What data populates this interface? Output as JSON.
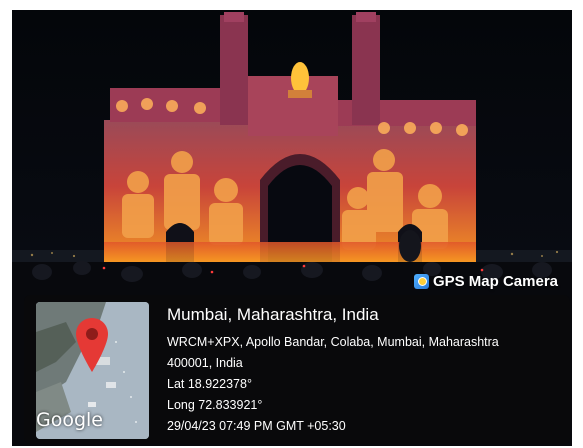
{
  "watermark": {
    "label": "GPS Map Camera",
    "icon": "gps-map-camera-icon"
  },
  "map": {
    "provider": "Google",
    "pin_color": "#e53935"
  },
  "location": {
    "city_line": "Mumbai, Maharashtra, India",
    "address_line1": "WRCM+XPX, Apollo Bandar, Colaba, Mumbai, Maharashtra",
    "address_line2": "400001, India",
    "lat": "Lat 18.922378°",
    "long": "Long 72.833921°",
    "datetime": "29/04/23 07:49 PM GMT +05:30"
  },
  "colors": {
    "panel_bg": "#0a0a0c",
    "light_orange": "#ff8a1e",
    "light_red": "#c8242a"
  }
}
